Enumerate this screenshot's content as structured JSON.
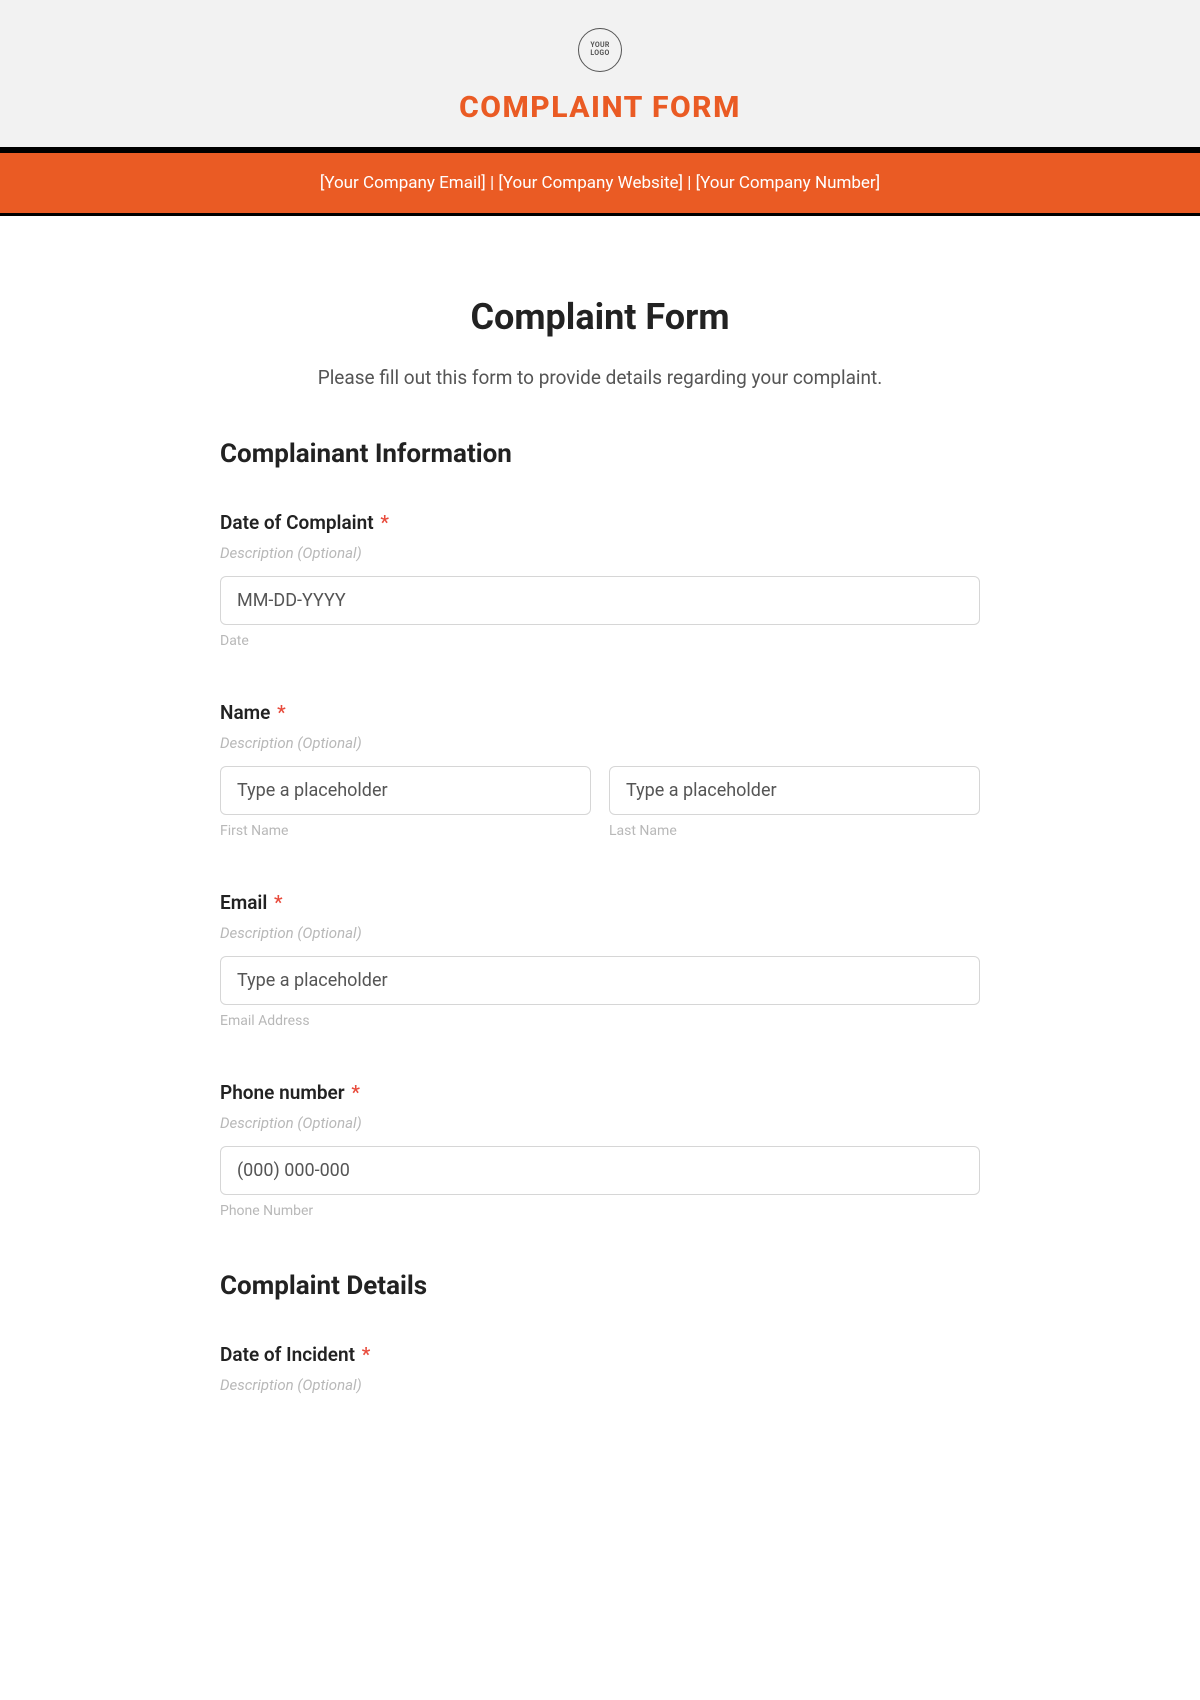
{
  "header": {
    "logo_text": "YOUR\nLOGO",
    "banner_title": "COMPLAINT FORM",
    "orange_bar": "[Your Company Email]  |  [Your Company Website]  |  [Your Company Number]"
  },
  "page": {
    "title": "Complaint Form",
    "subtitle": "Please fill out this form to provide details regarding your complaint."
  },
  "sections": {
    "complainant": {
      "heading": "Complainant Information",
      "fields": {
        "date_complaint": {
          "label": "Date of Complaint",
          "required": "*",
          "desc": "Description (Optional)",
          "placeholder": "MM-DD-YYYY",
          "sublabel": "Date"
        },
        "name": {
          "label": "Name",
          "required": "*",
          "desc": "Description (Optional)",
          "first_placeholder": "Type a placeholder",
          "last_placeholder": "Type a placeholder",
          "first_sublabel": "First Name",
          "last_sublabel": "Last Name"
        },
        "email": {
          "label": "Email",
          "required": "*",
          "desc": "Description (Optional)",
          "placeholder": "Type a placeholder",
          "sublabel": "Email Address"
        },
        "phone": {
          "label": "Phone number",
          "required": "*",
          "desc": "Description (Optional)",
          "placeholder": "(000) 000-000",
          "sublabel": "Phone Number"
        }
      }
    },
    "details": {
      "heading": "Complaint Details",
      "fields": {
        "date_incident": {
          "label": "Date of Incident",
          "required": "*",
          "desc": "Description (Optional)"
        }
      }
    }
  }
}
